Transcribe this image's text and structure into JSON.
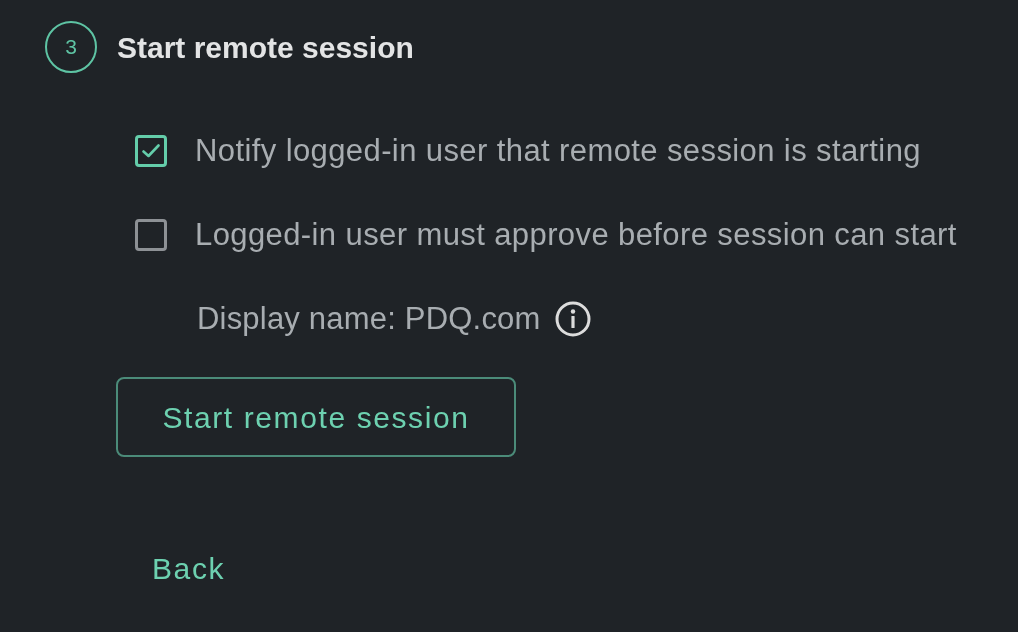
{
  "step": {
    "number": "3",
    "title": "Start remote session"
  },
  "options": [
    {
      "label": "Notify logged-in user that remote session is starting",
      "checked": true
    },
    {
      "label": "Logged-in user must approve before session can start",
      "checked": false
    }
  ],
  "display_name": {
    "label": "Display name: PDQ.com"
  },
  "primary_button": {
    "label": "Start remote session"
  },
  "back_link": {
    "label": "Back"
  }
}
